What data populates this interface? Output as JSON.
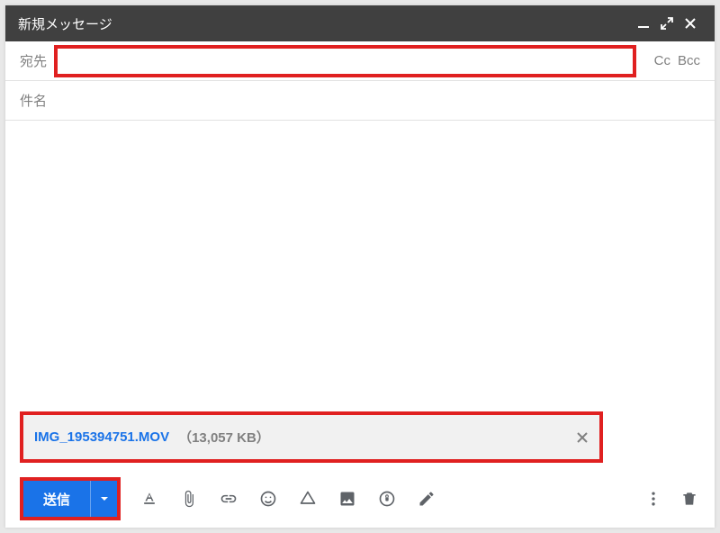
{
  "header": {
    "title": "新規メッセージ"
  },
  "fields": {
    "to_label": "宛先",
    "to_value": "",
    "subject_label": "件名",
    "subject_value": "",
    "cc_label": "Cc",
    "bcc_label": "Bcc"
  },
  "body": {
    "text": ""
  },
  "attachment": {
    "filename": "IMG_195394751.MOV",
    "size_display": "（13,057 KB）"
  },
  "toolbar": {
    "send_label": "送信"
  }
}
